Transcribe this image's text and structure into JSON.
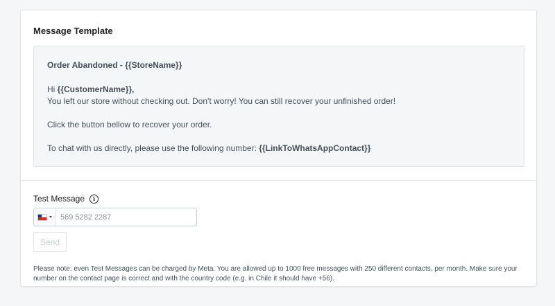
{
  "template": {
    "title": "Message Template",
    "header_prefix": "Order Abandoned - ",
    "header_var": "{{StoreName}}",
    "greeting_prefix": "Hi ",
    "greeting_var": "{{CustomerName}},",
    "line2": "You left our store without checking out. Don't worry! You can still recover your unfinished order!",
    "line3": "Click the button bellow to recover your order.",
    "line4_prefix": "To chat with us directly, please use the following number: ",
    "line4_var": "{{LinkToWhatsAppContact}}"
  },
  "test": {
    "label": "Test Message",
    "info_icon": "info-icon",
    "flag_icon": "chile-flag-icon",
    "phone_value": "",
    "phone_placeholder": "569 5282 2287",
    "send_label": "Send",
    "note": "Please note: even Test Messages can be charged by Meta. You are allowed up to 1000 free messages with 250 different contacts, per month. Make sure your number on the contact page is correct and with the country code (e.g. in Chile it should have +56)."
  }
}
